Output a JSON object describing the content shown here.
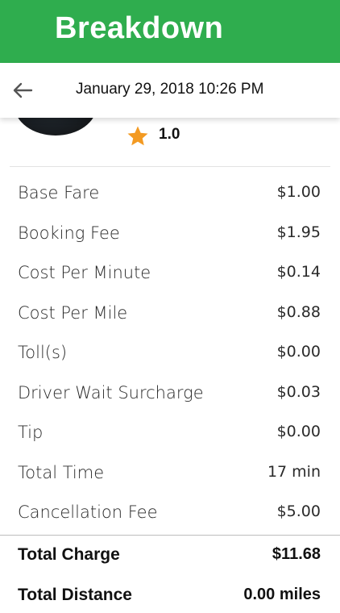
{
  "banner": {
    "title": "Breakdown"
  },
  "appbar": {
    "title": "January 29, 2018 10:26 PM"
  },
  "driver": {
    "rating": "1.0"
  },
  "breakdown": [
    {
      "label": "Base Fare",
      "value": "$1.00"
    },
    {
      "label": "Booking Fee",
      "value": "$1.95"
    },
    {
      "label": "Cost Per Minute",
      "value": "$0.14"
    },
    {
      "label": "Cost Per Mile",
      "value": "$0.88"
    },
    {
      "label": "Toll(s)",
      "value": "$0.00"
    },
    {
      "label": "Driver Wait Surcharge",
      "value": "$0.03"
    },
    {
      "label": "Tip",
      "value": "$0.00"
    },
    {
      "label": "Total Time",
      "value": "17 min"
    },
    {
      "label": "Cancellation Fee",
      "value": "$5.00"
    }
  ],
  "totals": {
    "charge_label": "Total Charge",
    "charge_value": "$11.68",
    "distance_label": "Total Distance",
    "distance_value": "0.00 miles"
  },
  "colors": {
    "banner_bg": "#2fad4e",
    "star": "#f39a22"
  },
  "icons": {
    "back": "arrow-back-icon",
    "star": "star-icon"
  }
}
